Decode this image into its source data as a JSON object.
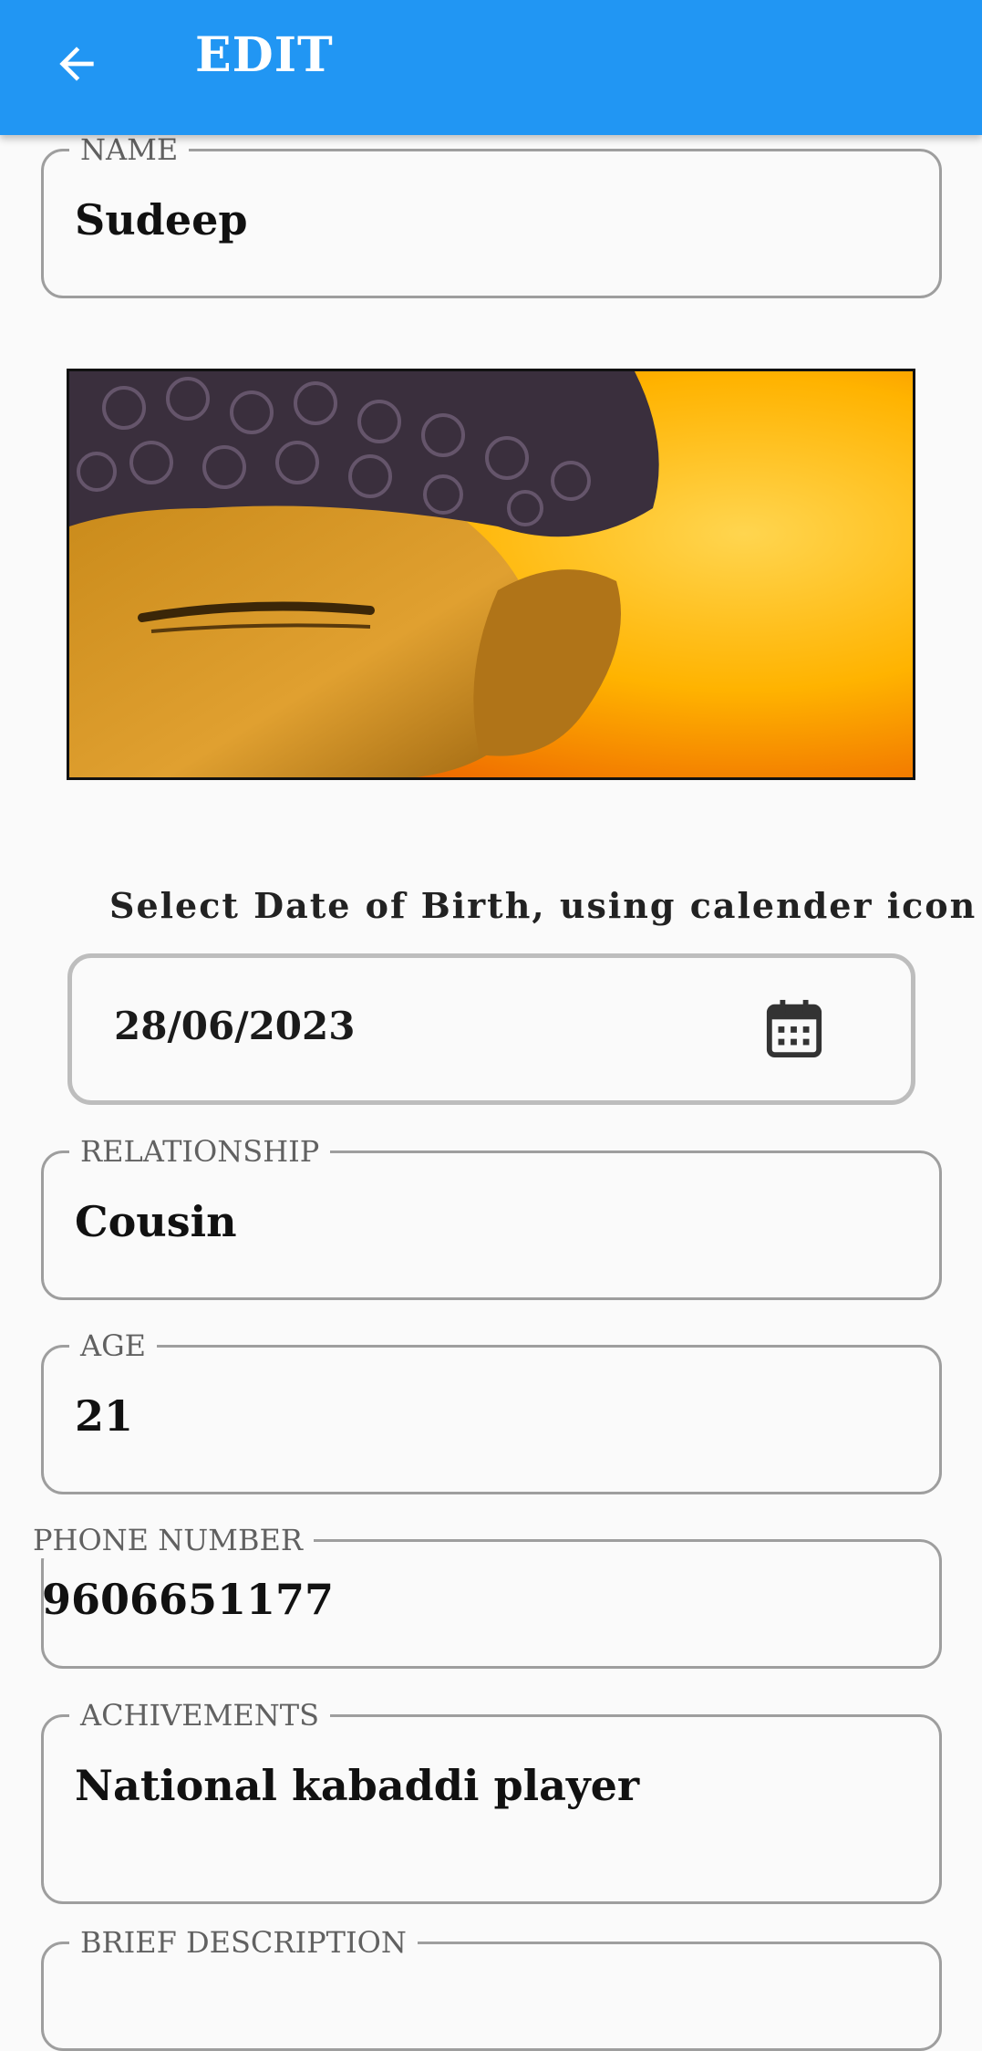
{
  "appbar": {
    "title": "EDIT",
    "back_icon": "arrow-left-icon"
  },
  "name_field": {
    "label": "NAME",
    "value": "Sudeep"
  },
  "photo": {
    "description_icon": "buddha-image"
  },
  "dob": {
    "hint": "Select Date of Birth, using calender icon",
    "value": "28/06/2023",
    "icon": "calendar-icon"
  },
  "relationship_field": {
    "label": "RELATIONSHIP",
    "value": "Cousin"
  },
  "age_field": {
    "label": "AGE",
    "value": "21"
  },
  "phone_field": {
    "label": "PHONE NUMBER",
    "value": "9606651177"
  },
  "achievements_field": {
    "label": "ACHIVEMENTS",
    "value": "National kabaddi player"
  },
  "brief_field": {
    "label": "BRIEF DESCRIPTION"
  },
  "colors": {
    "appbar": "#2196f3",
    "border": "#9e9e9e",
    "background": "#fafafa"
  }
}
